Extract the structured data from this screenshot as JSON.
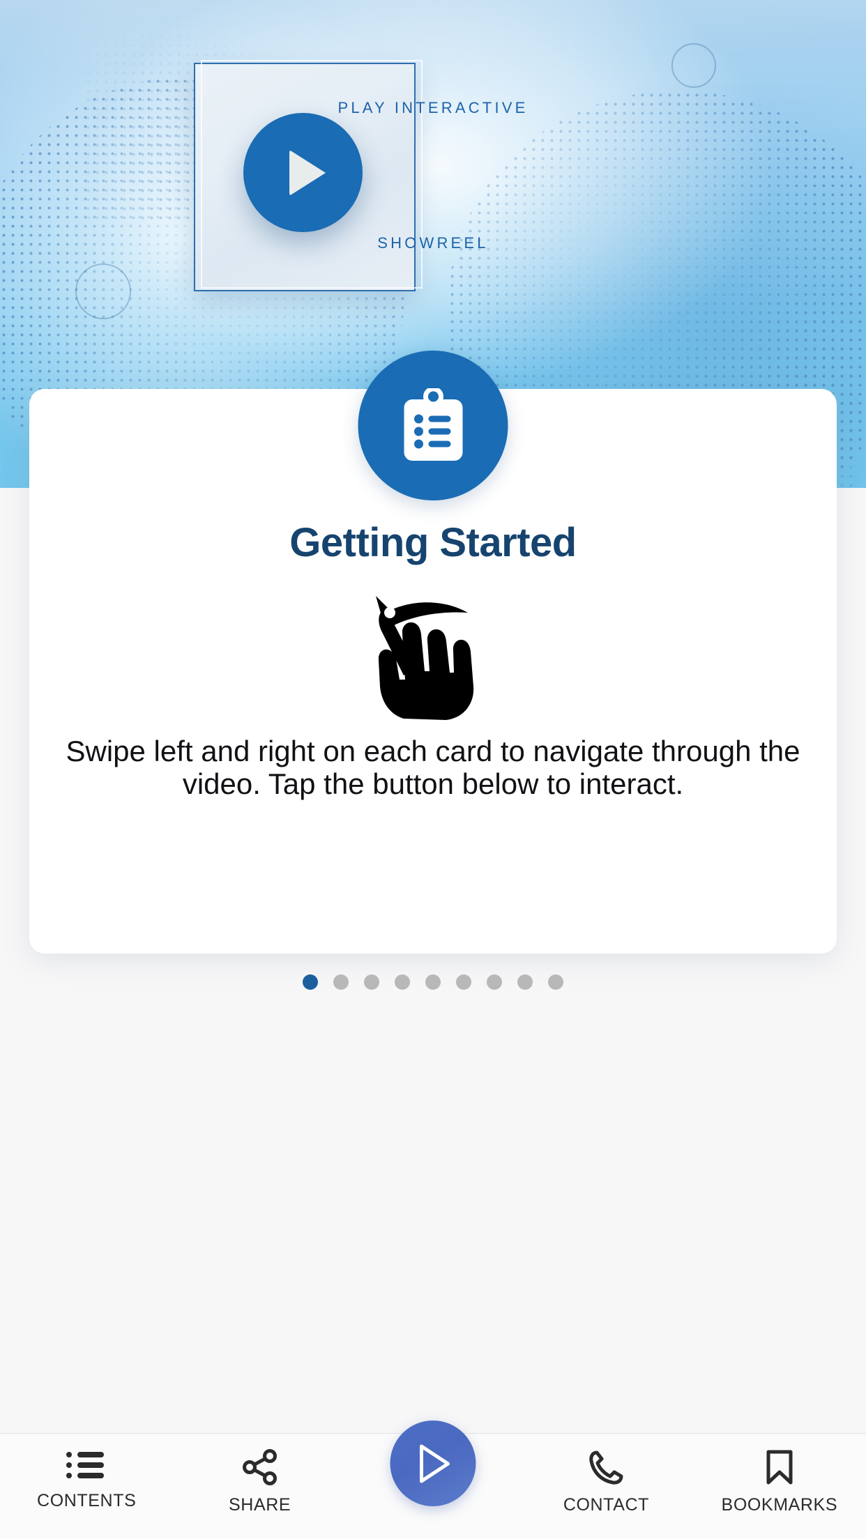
{
  "hero": {
    "frame_label_top": "PLAY INTERACTIVE",
    "frame_label_bottom": "SHOWREEL",
    "play_button_name": "play-showreel-button",
    "accent_blue": "#1a6cb4",
    "bg_blue": "#8ecdf0"
  },
  "card": {
    "badge_icon": "clipboard-checklist-icon",
    "title": "Getting Started",
    "gesture_icon": "swipe-hand-icon",
    "body": "Swipe left and right on each card to navigate through the video. Tap the button below to interact.",
    "badge_color": "#1a6cb4",
    "title_color": "#16446f"
  },
  "pager": {
    "total": 9,
    "active_index": 0,
    "active_color": "#1d5e9e",
    "inactive_color": "#b8b8b8"
  },
  "tabbar": {
    "items": [
      {
        "label": "CONTENTS",
        "icon": "list-icon"
      },
      {
        "label": "SHARE",
        "icon": "share-icon"
      },
      {
        "label": "CONTACT",
        "icon": "phone-icon"
      },
      {
        "label": "BOOKMARKS",
        "icon": "bookmark-icon"
      }
    ],
    "fab": {
      "icon": "play-icon",
      "color": "#4e6fc6"
    }
  }
}
